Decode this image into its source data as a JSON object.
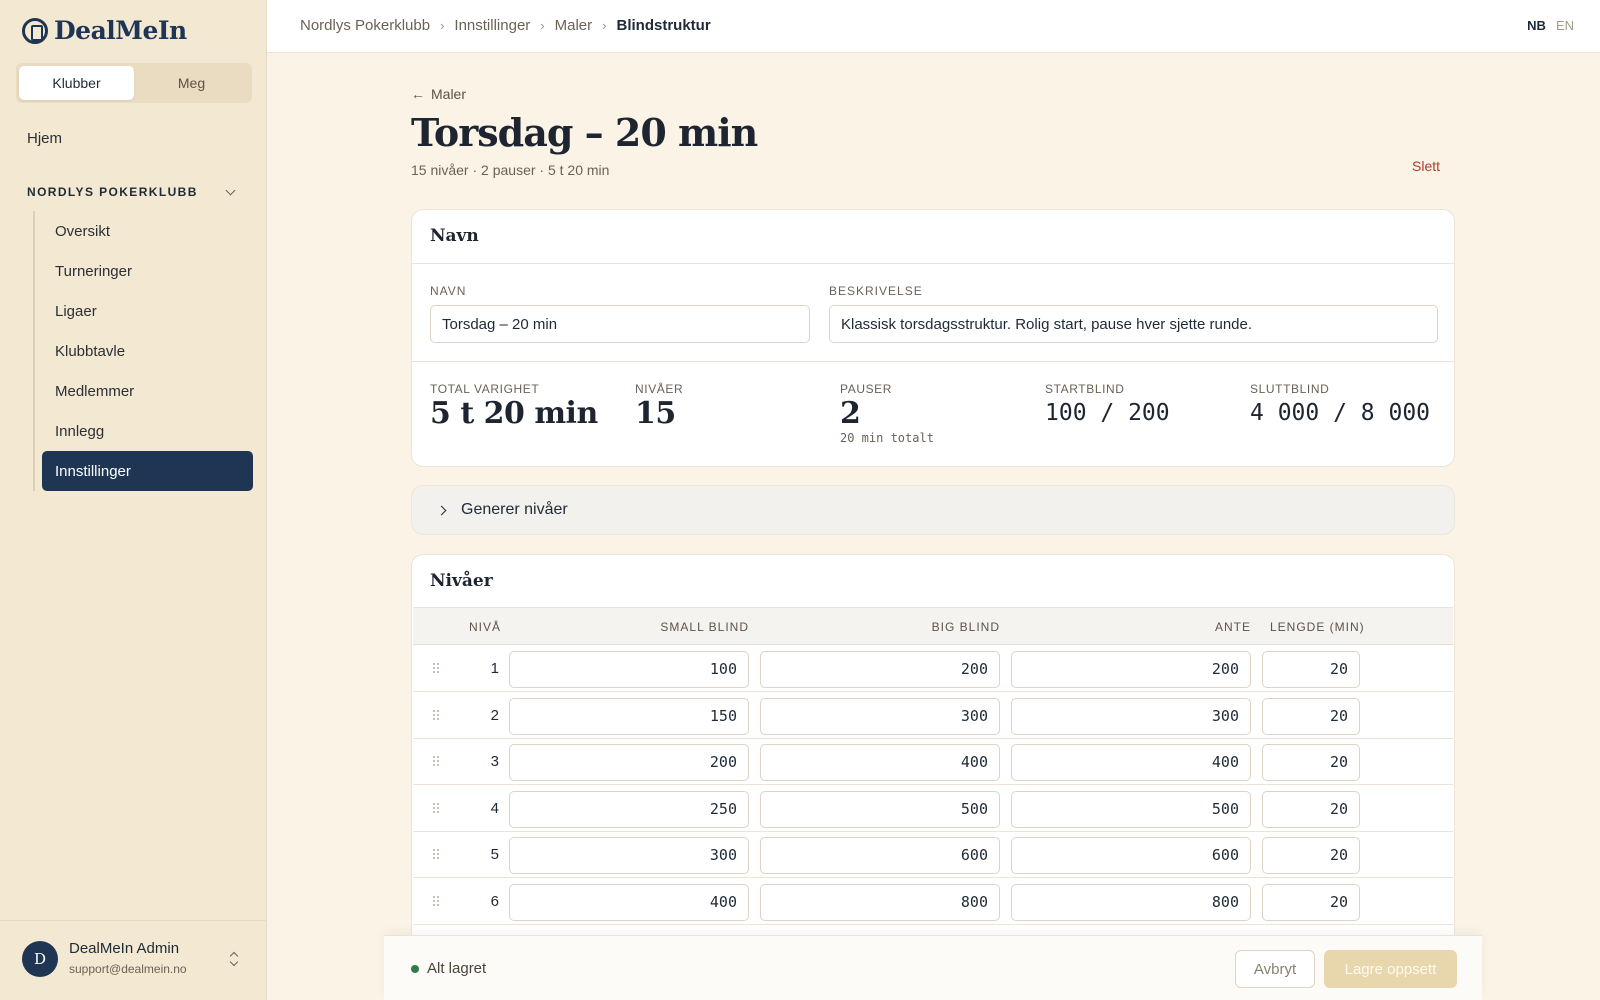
{
  "app": {
    "logo_text": "DealMeIn"
  },
  "sidebar": {
    "segments": [
      {
        "label": "Klubber",
        "active": true
      },
      {
        "label": "Meg",
        "active": false
      }
    ],
    "home_label": "Hjem",
    "club_name": "NORDLYS POKERKLUBB",
    "items": [
      {
        "label": "Oversikt"
      },
      {
        "label": "Turneringer"
      },
      {
        "label": "Ligaer"
      },
      {
        "label": "Klubbtavle"
      },
      {
        "label": "Medlemmer"
      },
      {
        "label": "Innlegg"
      },
      {
        "label": "Innstillinger",
        "active": true
      }
    ],
    "user": {
      "initial": "D",
      "name": "DealMeIn Admin",
      "email": "support@dealmein.no"
    }
  },
  "topbar": {
    "breadcrumbs": [
      "Nordlys Pokerklubb",
      "Innstillinger",
      "Maler",
      "Blindstruktur"
    ],
    "languages": {
      "active": "NB",
      "other": "EN"
    }
  },
  "page": {
    "back_label": "Maler",
    "title": "Torsdag – 20 min",
    "subtitle": "15 nivåer · 2 pauser · 5 t 20 min",
    "delete_label": "Slett"
  },
  "name_card": {
    "title": "Navn",
    "name_label": "NAVN",
    "name_value": "Torsdag – 20 min",
    "description_label": "BESKRIVELSE",
    "description_value": "Klassisk torsdagsstruktur. Rolig start, pause hver sjette runde."
  },
  "stats": {
    "total_label": "TOTAL VARIGHET",
    "total_value": "5 t 20 min",
    "levels_label": "NIVÅER",
    "levels_value": "15",
    "breaks_label": "PAUSER",
    "breaks_value": "2",
    "breaks_note": "20 min totalt",
    "start_label": "STARTBLIND",
    "start_value": "100 / 200",
    "end_label": "SLUTTBLIND",
    "end_value": "4 000 / 8 000"
  },
  "generate": {
    "label": "Generer nivåer"
  },
  "levels_card": {
    "title": "Nivåer",
    "headers": {
      "level": "NIVÅ",
      "small": "SMALL BLIND",
      "big": "BIG BLIND",
      "ante": "ANTE",
      "length": "LENGDE (MIN)"
    },
    "rows": [
      {
        "level": "1",
        "small": "100",
        "big": "200",
        "ante": "200",
        "length": "20"
      },
      {
        "level": "2",
        "small": "150",
        "big": "300",
        "ante": "300",
        "length": "20"
      },
      {
        "level": "3",
        "small": "200",
        "big": "400",
        "ante": "400",
        "length": "20"
      },
      {
        "level": "4",
        "small": "250",
        "big": "500",
        "ante": "500",
        "length": "20"
      },
      {
        "level": "5",
        "small": "300",
        "big": "600",
        "ante": "600",
        "length": "20"
      },
      {
        "level": "6",
        "small": "400",
        "big": "800",
        "ante": "800",
        "length": "20"
      }
    ]
  },
  "savebar": {
    "status": "Alt lagret",
    "cancel_label": "Avbryt",
    "save_label": "Lagre oppsett"
  }
}
